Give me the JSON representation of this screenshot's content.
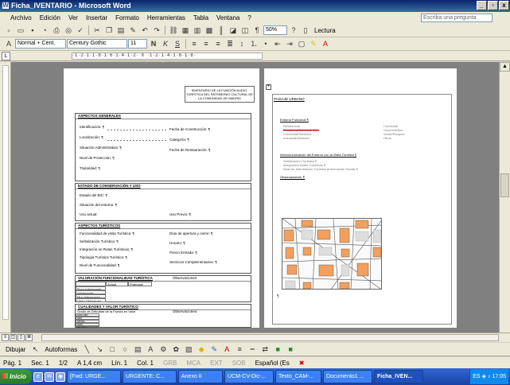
{
  "window": {
    "title": "Ficha_IVENTARIO - Microsoft Word",
    "minimize": "_",
    "restore": "▫",
    "close": "x"
  },
  "menu": {
    "items": [
      "Archivo",
      "Edición",
      "Ver",
      "Insertar",
      "Formato",
      "Herramientas",
      "Tabla",
      "Ventana",
      "?"
    ],
    "help_placeholder": "Escriba una pregunta"
  },
  "toolbar": {
    "zoom": "50%",
    "read_label": "Lectura"
  },
  "format": {
    "style": "Normal + Cent.",
    "font": "Century Gothic",
    "size": "11",
    "bold": "N",
    "italic": "K",
    "underline": "S"
  },
  "ruler": {
    "scale": "·1·2·1·1·8·1·6·1·4·1·2· X ·1·2·1·4·1·6·1·8·"
  },
  "page1": {
    "heading": "INVENTARIO DE LA FUNCIÓN AUDIO-TURÍSTICA DEL PATRIMONIO CULTURAL DE LA COMUNIDAD DE MADRID",
    "sec1": {
      "title": "ASPECTOS GENERALES",
      "identificacion": "Identificación: ¶",
      "localizacion": "Localización: ¶",
      "situacion": "Situación Administrativa: ¶",
      "nivel": "Nivel de Protección: ¶",
      "titularidad": "Titularidad: ¶",
      "fecha_construccion": "Fecha de Construcción: ¶",
      "categoria": "Categoría: ¶",
      "fecha_restauracion": "Fecha de Restauración: ¶"
    },
    "sec2": {
      "title": "ESTADO DE CONSERVACIÓN Y USO",
      "estado": "Estado del BIC: ¶",
      "situacion": "Situación del entorno: ¶",
      "uso": "Uso actual:",
      "uso_previo": "Uso Previo: ¶"
    },
    "sec3": {
      "title": "ASPECTOS TURÍSTICOS",
      "funcionalidad": "Funcionalidad de visita Turística: ¶",
      "senalizacion": "Señalización Turística: ¶",
      "integracion": "Integración en Rutas Turísticas: ¶",
      "tipologia": "Tipología Turística Turística: ¶",
      "nivel": "Nivel de Funcionalidad: ¶",
      "dias": "Días de apertura y cierre: ¶",
      "horario": "Horario: ¶",
      "precio": "Precio Entrada: ¶",
      "servicios": "Servicios Complementarios: ¶"
    },
    "sec4": {
      "title": "VALORACIÓN FUNCIONALIDAD TURÍSTICA",
      "observaciones": "Observaciones:",
      "col_actual": "Actual",
      "col_potencial": "Potencial",
      "rows": [
        "Poco Interesante",
        "Interesante",
        "Muy Interesante",
        "Visita Obligatoria"
      ]
    },
    "sec5": {
      "title": "CUALIDADES Y VALOR TURÍSTICO",
      "subtitle": "Grado de Dificultad de la Puesta en Valor",
      "observaciones": "Observaciones:",
      "rows": [
        "Muy Alto",
        "Alto",
        "Medio",
        "Bajo",
        "Muy Bajo"
      ]
    }
  },
  "page2": {
    "title": "PAISAJE URBANO",
    "entorno_funcional": "Entorno Funcional ¶",
    "items_left": [
      "Residencial",
      "Comercial/Servicios",
      "Industrial/Almacén"
    ],
    "items_left_struck": "Dotacional Administrativo",
    "items_right": [
      "Comercial",
      "Ocio/Hotelero",
      "Verde/Parques",
      "Otros"
    ],
    "intercomunicacion": "Intercomunicación del Entorno con la Visita Turística ¶",
    "sub_items": [
      "Señalización Turística ¶",
      "Integración Rutas Turísticas ¶",
      "Nivel de Interrelación Turística (Información Social) ¶"
    ],
    "observaciones": "Observaciones: ¶"
  },
  "draw": {
    "dibujar": "Dibujar",
    "autoformas": "Autoformas"
  },
  "status": {
    "page": "Pág. 1",
    "section": "Sec. 1",
    "pages": "1/2",
    "at": "A 1,4 cm",
    "line": "Lín. 1",
    "col": "Col. 1",
    "grb": "GRB",
    "mca": "MCA",
    "ext": "EXT",
    "sob": "SOB",
    "lang": "Español (Es"
  },
  "taskbar": {
    "start": "Inicio",
    "tasks": [
      "[Fwd: URGE...",
      "URGENTE: C...",
      "Anexo II",
      "UCM-CV-Dic-...",
      "Texto_CAM-...",
      "Documento1 ...",
      "Ficha_IVEN..."
    ],
    "lang": "ES",
    "clock": "17:05"
  }
}
